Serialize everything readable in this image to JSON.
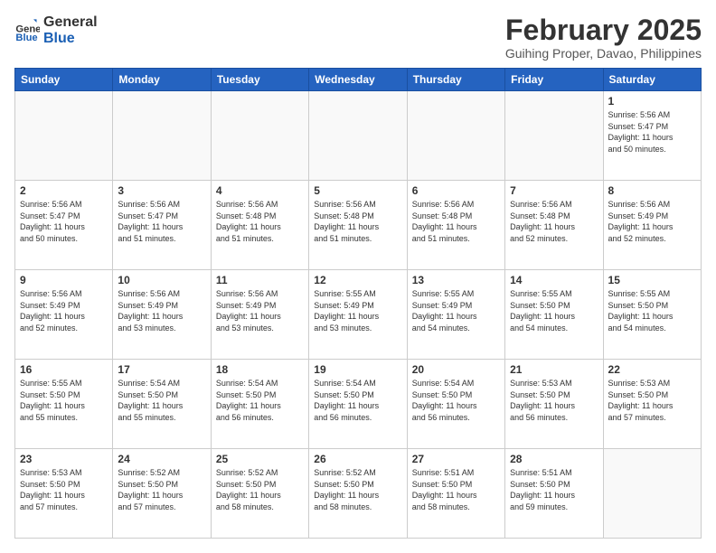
{
  "header": {
    "logo_general": "General",
    "logo_blue": "Blue",
    "title": "February 2025",
    "subtitle": "Guihing Proper, Davao, Philippines"
  },
  "weekdays": [
    "Sunday",
    "Monday",
    "Tuesday",
    "Wednesday",
    "Thursday",
    "Friday",
    "Saturday"
  ],
  "weeks": [
    [
      {
        "day": "",
        "info": ""
      },
      {
        "day": "",
        "info": ""
      },
      {
        "day": "",
        "info": ""
      },
      {
        "day": "",
        "info": ""
      },
      {
        "day": "",
        "info": ""
      },
      {
        "day": "",
        "info": ""
      },
      {
        "day": "1",
        "info": "Sunrise: 5:56 AM\nSunset: 5:47 PM\nDaylight: 11 hours\nand 50 minutes."
      }
    ],
    [
      {
        "day": "2",
        "info": "Sunrise: 5:56 AM\nSunset: 5:47 PM\nDaylight: 11 hours\nand 50 minutes."
      },
      {
        "day": "3",
        "info": "Sunrise: 5:56 AM\nSunset: 5:47 PM\nDaylight: 11 hours\nand 51 minutes."
      },
      {
        "day": "4",
        "info": "Sunrise: 5:56 AM\nSunset: 5:48 PM\nDaylight: 11 hours\nand 51 minutes."
      },
      {
        "day": "5",
        "info": "Sunrise: 5:56 AM\nSunset: 5:48 PM\nDaylight: 11 hours\nand 51 minutes."
      },
      {
        "day": "6",
        "info": "Sunrise: 5:56 AM\nSunset: 5:48 PM\nDaylight: 11 hours\nand 51 minutes."
      },
      {
        "day": "7",
        "info": "Sunrise: 5:56 AM\nSunset: 5:48 PM\nDaylight: 11 hours\nand 52 minutes."
      },
      {
        "day": "8",
        "info": "Sunrise: 5:56 AM\nSunset: 5:49 PM\nDaylight: 11 hours\nand 52 minutes."
      }
    ],
    [
      {
        "day": "9",
        "info": "Sunrise: 5:56 AM\nSunset: 5:49 PM\nDaylight: 11 hours\nand 52 minutes."
      },
      {
        "day": "10",
        "info": "Sunrise: 5:56 AM\nSunset: 5:49 PM\nDaylight: 11 hours\nand 53 minutes."
      },
      {
        "day": "11",
        "info": "Sunrise: 5:56 AM\nSunset: 5:49 PM\nDaylight: 11 hours\nand 53 minutes."
      },
      {
        "day": "12",
        "info": "Sunrise: 5:55 AM\nSunset: 5:49 PM\nDaylight: 11 hours\nand 53 minutes."
      },
      {
        "day": "13",
        "info": "Sunrise: 5:55 AM\nSunset: 5:49 PM\nDaylight: 11 hours\nand 54 minutes."
      },
      {
        "day": "14",
        "info": "Sunrise: 5:55 AM\nSunset: 5:50 PM\nDaylight: 11 hours\nand 54 minutes."
      },
      {
        "day": "15",
        "info": "Sunrise: 5:55 AM\nSunset: 5:50 PM\nDaylight: 11 hours\nand 54 minutes."
      }
    ],
    [
      {
        "day": "16",
        "info": "Sunrise: 5:55 AM\nSunset: 5:50 PM\nDaylight: 11 hours\nand 55 minutes."
      },
      {
        "day": "17",
        "info": "Sunrise: 5:54 AM\nSunset: 5:50 PM\nDaylight: 11 hours\nand 55 minutes."
      },
      {
        "day": "18",
        "info": "Sunrise: 5:54 AM\nSunset: 5:50 PM\nDaylight: 11 hours\nand 56 minutes."
      },
      {
        "day": "19",
        "info": "Sunrise: 5:54 AM\nSunset: 5:50 PM\nDaylight: 11 hours\nand 56 minutes."
      },
      {
        "day": "20",
        "info": "Sunrise: 5:54 AM\nSunset: 5:50 PM\nDaylight: 11 hours\nand 56 minutes."
      },
      {
        "day": "21",
        "info": "Sunrise: 5:53 AM\nSunset: 5:50 PM\nDaylight: 11 hours\nand 56 minutes."
      },
      {
        "day": "22",
        "info": "Sunrise: 5:53 AM\nSunset: 5:50 PM\nDaylight: 11 hours\nand 57 minutes."
      }
    ],
    [
      {
        "day": "23",
        "info": "Sunrise: 5:53 AM\nSunset: 5:50 PM\nDaylight: 11 hours\nand 57 minutes."
      },
      {
        "day": "24",
        "info": "Sunrise: 5:52 AM\nSunset: 5:50 PM\nDaylight: 11 hours\nand 57 minutes."
      },
      {
        "day": "25",
        "info": "Sunrise: 5:52 AM\nSunset: 5:50 PM\nDaylight: 11 hours\nand 58 minutes."
      },
      {
        "day": "26",
        "info": "Sunrise: 5:52 AM\nSunset: 5:50 PM\nDaylight: 11 hours\nand 58 minutes."
      },
      {
        "day": "27",
        "info": "Sunrise: 5:51 AM\nSunset: 5:50 PM\nDaylight: 11 hours\nand 58 minutes."
      },
      {
        "day": "28",
        "info": "Sunrise: 5:51 AM\nSunset: 5:50 PM\nDaylight: 11 hours\nand 59 minutes."
      },
      {
        "day": "",
        "info": ""
      }
    ]
  ]
}
